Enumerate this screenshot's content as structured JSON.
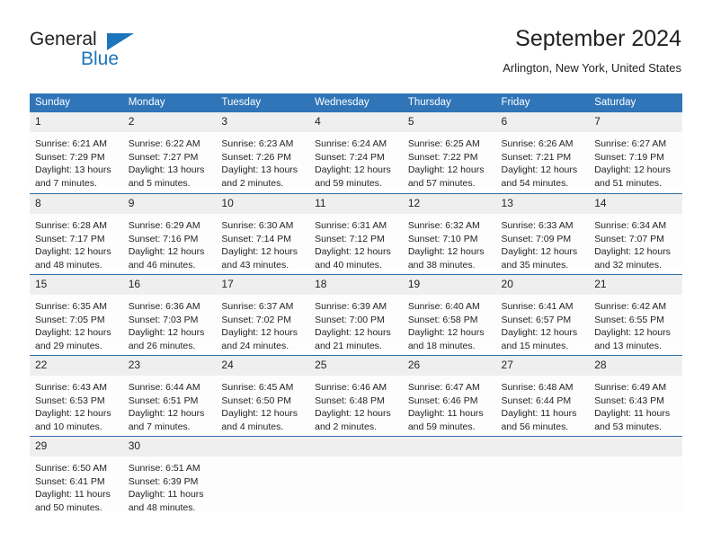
{
  "brand": {
    "name_top": "General",
    "name_bottom": "Blue",
    "accent_color": "#1b75bc"
  },
  "header": {
    "title": "September 2024",
    "location": "Arlington, New York, United States"
  },
  "theme": {
    "header_blue": "#3075b8",
    "row_separator": "#2f6fa8",
    "daynum_background": "#efefef",
    "cell_background": "#fdfdfd"
  },
  "weekday_headers": [
    "Sunday",
    "Monday",
    "Tuesday",
    "Wednesday",
    "Thursday",
    "Friday",
    "Saturday"
  ],
  "weeks": [
    [
      {
        "day": "1",
        "sunrise": "Sunrise: 6:21 AM",
        "sunset": "Sunset: 7:29 PM",
        "daylight": "Daylight: 13 hours and 7 minutes."
      },
      {
        "day": "2",
        "sunrise": "Sunrise: 6:22 AM",
        "sunset": "Sunset: 7:27 PM",
        "daylight": "Daylight: 13 hours and 5 minutes."
      },
      {
        "day": "3",
        "sunrise": "Sunrise: 6:23 AM",
        "sunset": "Sunset: 7:26 PM",
        "daylight": "Daylight: 13 hours and 2 minutes."
      },
      {
        "day": "4",
        "sunrise": "Sunrise: 6:24 AM",
        "sunset": "Sunset: 7:24 PM",
        "daylight": "Daylight: 12 hours and 59 minutes."
      },
      {
        "day": "5",
        "sunrise": "Sunrise: 6:25 AM",
        "sunset": "Sunset: 7:22 PM",
        "daylight": "Daylight: 12 hours and 57 minutes."
      },
      {
        "day": "6",
        "sunrise": "Sunrise: 6:26 AM",
        "sunset": "Sunset: 7:21 PM",
        "daylight": "Daylight: 12 hours and 54 minutes."
      },
      {
        "day": "7",
        "sunrise": "Sunrise: 6:27 AM",
        "sunset": "Sunset: 7:19 PM",
        "daylight": "Daylight: 12 hours and 51 minutes."
      }
    ],
    [
      {
        "day": "8",
        "sunrise": "Sunrise: 6:28 AM",
        "sunset": "Sunset: 7:17 PM",
        "daylight": "Daylight: 12 hours and 48 minutes."
      },
      {
        "day": "9",
        "sunrise": "Sunrise: 6:29 AM",
        "sunset": "Sunset: 7:16 PM",
        "daylight": "Daylight: 12 hours and 46 minutes."
      },
      {
        "day": "10",
        "sunrise": "Sunrise: 6:30 AM",
        "sunset": "Sunset: 7:14 PM",
        "daylight": "Daylight: 12 hours and 43 minutes."
      },
      {
        "day": "11",
        "sunrise": "Sunrise: 6:31 AM",
        "sunset": "Sunset: 7:12 PM",
        "daylight": "Daylight: 12 hours and 40 minutes."
      },
      {
        "day": "12",
        "sunrise": "Sunrise: 6:32 AM",
        "sunset": "Sunset: 7:10 PM",
        "daylight": "Daylight: 12 hours and 38 minutes."
      },
      {
        "day": "13",
        "sunrise": "Sunrise: 6:33 AM",
        "sunset": "Sunset: 7:09 PM",
        "daylight": "Daylight: 12 hours and 35 minutes."
      },
      {
        "day": "14",
        "sunrise": "Sunrise: 6:34 AM",
        "sunset": "Sunset: 7:07 PM",
        "daylight": "Daylight: 12 hours and 32 minutes."
      }
    ],
    [
      {
        "day": "15",
        "sunrise": "Sunrise: 6:35 AM",
        "sunset": "Sunset: 7:05 PM",
        "daylight": "Daylight: 12 hours and 29 minutes."
      },
      {
        "day": "16",
        "sunrise": "Sunrise: 6:36 AM",
        "sunset": "Sunset: 7:03 PM",
        "daylight": "Daylight: 12 hours and 26 minutes."
      },
      {
        "day": "17",
        "sunrise": "Sunrise: 6:37 AM",
        "sunset": "Sunset: 7:02 PM",
        "daylight": "Daylight: 12 hours and 24 minutes."
      },
      {
        "day": "18",
        "sunrise": "Sunrise: 6:39 AM",
        "sunset": "Sunset: 7:00 PM",
        "daylight": "Daylight: 12 hours and 21 minutes."
      },
      {
        "day": "19",
        "sunrise": "Sunrise: 6:40 AM",
        "sunset": "Sunset: 6:58 PM",
        "daylight": "Daylight: 12 hours and 18 minutes."
      },
      {
        "day": "20",
        "sunrise": "Sunrise: 6:41 AM",
        "sunset": "Sunset: 6:57 PM",
        "daylight": "Daylight: 12 hours and 15 minutes."
      },
      {
        "day": "21",
        "sunrise": "Sunrise: 6:42 AM",
        "sunset": "Sunset: 6:55 PM",
        "daylight": "Daylight: 12 hours and 13 minutes."
      }
    ],
    [
      {
        "day": "22",
        "sunrise": "Sunrise: 6:43 AM",
        "sunset": "Sunset: 6:53 PM",
        "daylight": "Daylight: 12 hours and 10 minutes."
      },
      {
        "day": "23",
        "sunrise": "Sunrise: 6:44 AM",
        "sunset": "Sunset: 6:51 PM",
        "daylight": "Daylight: 12 hours and 7 minutes."
      },
      {
        "day": "24",
        "sunrise": "Sunrise: 6:45 AM",
        "sunset": "Sunset: 6:50 PM",
        "daylight": "Daylight: 12 hours and 4 minutes."
      },
      {
        "day": "25",
        "sunrise": "Sunrise: 6:46 AM",
        "sunset": "Sunset: 6:48 PM",
        "daylight": "Daylight: 12 hours and 2 minutes."
      },
      {
        "day": "26",
        "sunrise": "Sunrise: 6:47 AM",
        "sunset": "Sunset: 6:46 PM",
        "daylight": "Daylight: 11 hours and 59 minutes."
      },
      {
        "day": "27",
        "sunrise": "Sunrise: 6:48 AM",
        "sunset": "Sunset: 6:44 PM",
        "daylight": "Daylight: 11 hours and 56 minutes."
      },
      {
        "day": "28",
        "sunrise": "Sunrise: 6:49 AM",
        "sunset": "Sunset: 6:43 PM",
        "daylight": "Daylight: 11 hours and 53 minutes."
      }
    ],
    [
      {
        "day": "29",
        "sunrise": "Sunrise: 6:50 AM",
        "sunset": "Sunset: 6:41 PM",
        "daylight": "Daylight: 11 hours and 50 minutes."
      },
      {
        "day": "30",
        "sunrise": "Sunrise: 6:51 AM",
        "sunset": "Sunset: 6:39 PM",
        "daylight": "Daylight: 11 hours and 48 minutes."
      },
      {
        "day": "",
        "sunrise": "",
        "sunset": "",
        "daylight": ""
      },
      {
        "day": "",
        "sunrise": "",
        "sunset": "",
        "daylight": ""
      },
      {
        "day": "",
        "sunrise": "",
        "sunset": "",
        "daylight": ""
      },
      {
        "day": "",
        "sunrise": "",
        "sunset": "",
        "daylight": ""
      },
      {
        "day": "",
        "sunrise": "",
        "sunset": "",
        "daylight": ""
      }
    ]
  ]
}
